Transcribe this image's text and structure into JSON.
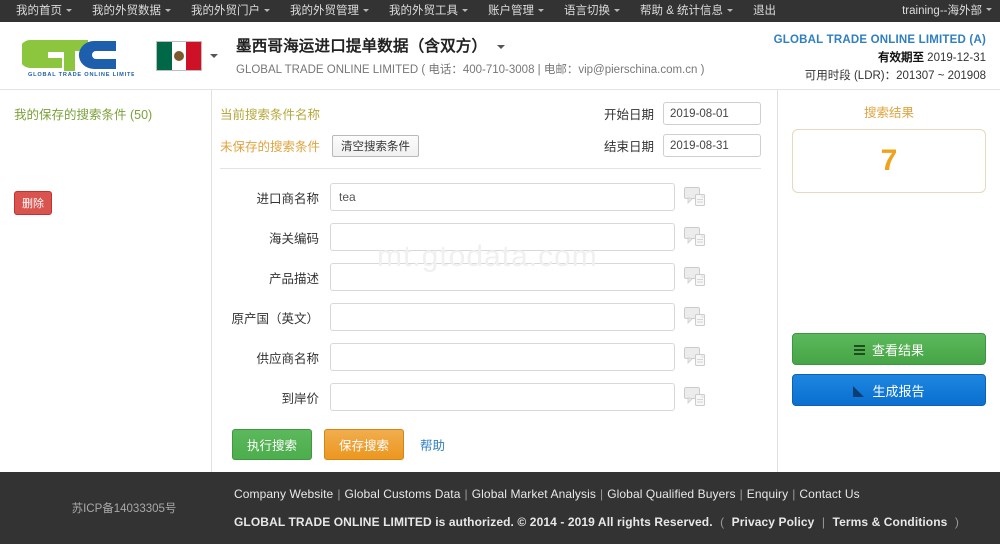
{
  "topnav": {
    "items": [
      {
        "label": "我的首页",
        "caret": true
      },
      {
        "label": "我的外贸数据",
        "caret": true
      },
      {
        "label": "我的外贸门户",
        "caret": true
      },
      {
        "label": "我的外贸管理",
        "caret": true
      },
      {
        "label": "我的外贸工具",
        "caret": true
      },
      {
        "label": "账户管理",
        "caret": true
      },
      {
        "label": "语言切换",
        "caret": true
      },
      {
        "label": "帮助 & 统计信息",
        "caret": true
      },
      {
        "label": "退出",
        "caret": false
      }
    ],
    "user": "training--海外部"
  },
  "header": {
    "logo_text": "GLOBAL TRADE ONLINE LIMITED",
    "flag": "mexico-flag",
    "title": "墨西哥海运进口提单数据（含双方）",
    "subtitle": "GLOBAL TRADE ONLINE LIMITED ( 电话：400-710-3008 | 电邮：vip@pierschina.com.cn )",
    "account_name": "GLOBAL TRADE ONLINE LIMITED (A)",
    "expiry_label": "有效期至",
    "expiry_value": "2019-12-31",
    "ldr_label": "可用时段 (LDR)：",
    "ldr_value": "201307 ~ 201908"
  },
  "sidebar": {
    "saved_title": "我的保存的搜索条件 (50)",
    "delete_label": "删除"
  },
  "search_conditions": {
    "current_name_label": "当前搜索条件名称",
    "unsaved_label": "未保存的搜索条件",
    "clear_button": "清空搜索条件",
    "start_date_label": "开始日期",
    "start_date_value": "2019-08-01",
    "end_date_label": "结束日期",
    "end_date_value": "2019-08-31"
  },
  "form": {
    "fields": [
      {
        "label": "进口商名称",
        "value": "tea",
        "placeholder": "",
        "icon": "note-icon"
      },
      {
        "label": "海关编码",
        "value": "",
        "placeholder": "",
        "icon": "note-icon"
      },
      {
        "label": "产品描述",
        "value": "",
        "placeholder": "",
        "icon": "note-icon"
      },
      {
        "label": "原产国（英文）",
        "value": "",
        "placeholder": "",
        "icon": "note-icon"
      },
      {
        "label": "供应商名称",
        "value": "",
        "placeholder": "",
        "icon": "note-icon"
      },
      {
        "label": "到岸价",
        "value": "",
        "placeholder": "",
        "icon": "note-icon"
      }
    ],
    "exec_button": "执行搜索",
    "save_button": "保存搜索",
    "help_link": "帮助"
  },
  "watermark": "mt.gtodata.com",
  "results": {
    "title": "搜索结果",
    "count": "7",
    "view_button": "查看结果",
    "report_button": "生成报告"
  },
  "footer": {
    "icp": "苏ICP备14033305号",
    "links": [
      "Company Website",
      "Global Customs Data",
      "Global Market Analysis",
      "Global Qualified Buyers",
      "Enquiry",
      "Contact Us"
    ],
    "copyright": "GLOBAL TRADE ONLINE LIMITED is authorized. © 2014 - 2019 All rights Reserved.",
    "privacy": "Privacy Policy",
    "terms": "Terms & Conditions"
  },
  "colors": {
    "brand_green": "#8cc63f",
    "brand_blue": "#1d5fad",
    "accent_orange": "#f0a21c",
    "nav_bg": "#333333"
  }
}
